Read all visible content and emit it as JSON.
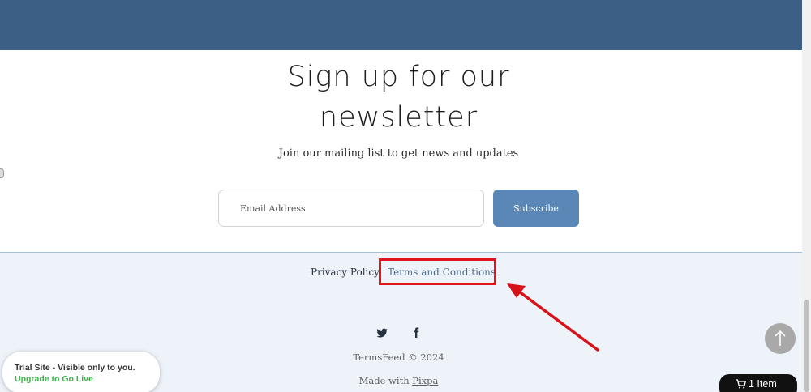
{
  "newsletter": {
    "title_line1": "Sign up for our",
    "title_line2": "newsletter",
    "subtitle": "Join our mailing list to get news and updates",
    "email_placeholder": "Email Address",
    "subscribe_label": "Subscribe"
  },
  "footer": {
    "privacy_label": "Privacy Policy",
    "terms_label": "Terms and Conditions",
    "social_icons": [
      "twitter-icon",
      "facebook-icon"
    ],
    "copyright": "TermsFeed © 2024",
    "made_with_prefix": "Made with ",
    "made_with_link": "Pixpa"
  },
  "trial_badge": {
    "line": "Trial Site - Visible only to you.",
    "link": "Upgrade to Go Live"
  },
  "cart": {
    "label": "1 Item",
    "icon": "cart-icon"
  },
  "back_to_top_icon": "arrow-up-icon",
  "colors": {
    "banner": "#3b5f85",
    "subscribe_button": "#5a87b5",
    "footer_bg": "#eef3fa",
    "highlight": "#e0151c",
    "go_live": "#3bb34a"
  }
}
